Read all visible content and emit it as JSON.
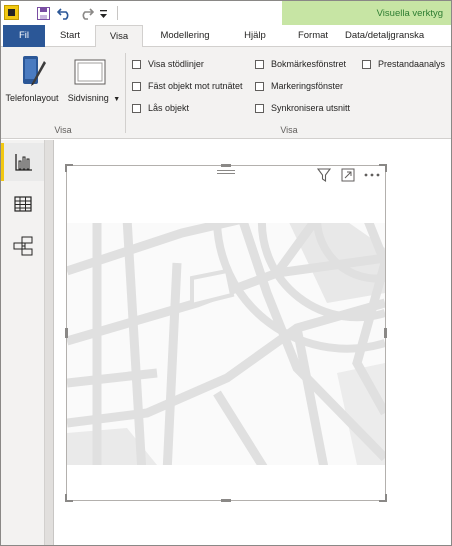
{
  "titlebar": {
    "quick_access": [
      "save-icon",
      "undo-icon",
      "redo-icon",
      "customize-icon"
    ],
    "context_label": "Visuella verktyg"
  },
  "tabs": [
    {
      "label": "Fil"
    },
    {
      "label": "Start"
    },
    {
      "label": "Visa"
    },
    {
      "label": "Modellering"
    },
    {
      "label": "Hjälp"
    },
    {
      "label": "Format"
    },
    {
      "label": "Data/detaljgranska"
    }
  ],
  "ribbon": {
    "group1": {
      "buttons": [
        {
          "label": "Telefonlayout",
          "icon": "phone-layout-icon"
        },
        {
          "label": "Sidvisning",
          "icon": "page-view-icon",
          "has_dropdown": true
        }
      ],
      "label": "Visa"
    },
    "group2": {
      "checkboxes": [
        {
          "label": "Visa stödlinjer",
          "checked": false
        },
        {
          "label": "Fäst objekt mot rutnätet",
          "checked": false
        },
        {
          "label": "Lås objekt",
          "checked": false
        },
        {
          "label": "Bokmärkesfönstret",
          "checked": false
        },
        {
          "label": "Markeringsfönster",
          "checked": false
        },
        {
          "label": "Synkronisera utsnitt",
          "checked": false
        },
        {
          "label": "Prestandaanalys",
          "checked": false
        }
      ],
      "label": "Visa"
    }
  },
  "rail": {
    "items": [
      {
        "name": "report-view",
        "icon": "bar-chart-icon",
        "active": true
      },
      {
        "name": "data-view",
        "icon": "table-icon",
        "active": false
      },
      {
        "name": "model-view",
        "icon": "model-icon",
        "active": false
      }
    ]
  },
  "visual": {
    "header_icons": [
      "filter-icon",
      "focus-mode-icon",
      "more-options-icon"
    ],
    "content": "map-placeholder"
  },
  "colors": {
    "file_tab": "#2b5797",
    "context_band": "#c7e5a4",
    "context_text": "#2e7d32",
    "rail_active": "#f2c811",
    "map_road": "#e0e0e0"
  }
}
